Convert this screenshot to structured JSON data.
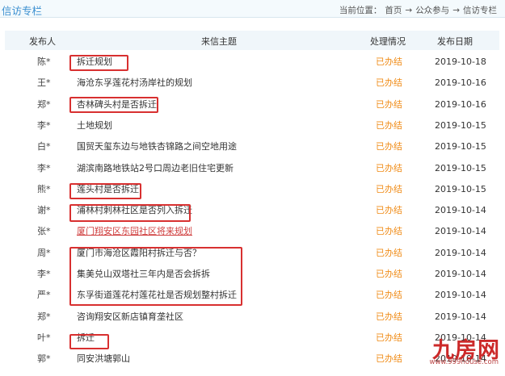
{
  "page": {
    "section_title": "信访专栏",
    "breadcrumb": {
      "label": "当前位置：",
      "home": "首页",
      "arrow": "→",
      "level1": "公众参与",
      "level2": "信访专栏"
    }
  },
  "table": {
    "headers": {
      "author": "发布人",
      "subject": "来信主题",
      "status": "处理情况",
      "date": "发布日期"
    },
    "rows": [
      {
        "author": "陈*",
        "subject": "拆迁规划",
        "status": "已办结",
        "date": "2019-10-18"
      },
      {
        "author": "王*",
        "subject": "海沧东孚莲花村汤岸社的规划",
        "status": "已办结",
        "date": "2019-10-16"
      },
      {
        "author": "郑*",
        "subject": "杏林碑头村是否拆迁",
        "status": "已办结",
        "date": "2019-10-16"
      },
      {
        "author": "李*",
        "subject": "土地规划",
        "status": "已办结",
        "date": "2019-10-15"
      },
      {
        "author": "白*",
        "subject": "国贸天玺东边与地铁杏锦路之间空地用途",
        "status": "已办结",
        "date": "2019-10-15"
      },
      {
        "author": "李*",
        "subject": "湖滨南路地铁站2号口周边老旧住宅更新",
        "status": "已办结",
        "date": "2019-10-15"
      },
      {
        "author": "熊*",
        "subject": "莲头村是否拆迁",
        "status": "已办结",
        "date": "2019-10-15"
      },
      {
        "author": "谢*",
        "subject": "浦林村刺林社区是否列入拆迁",
        "status": "已办结",
        "date": "2019-10-14"
      },
      {
        "author": "张*",
        "subject": "厦门翔安区东园社区将来规划",
        "status": "已办结",
        "date": "2019-10-14"
      },
      {
        "author": "周*",
        "subject": "厦门市海沧区霞阳村拆迁与否？",
        "status": "已办结",
        "date": "2019-10-14"
      },
      {
        "author": "李*",
        "subject": "集美兑山双塔社三年内是否会拆拆",
        "status": "已办结",
        "date": "2019-10-14"
      },
      {
        "author": "严*",
        "subject": "东孚街道莲花村莲花社是否规划整村拆迁",
        "status": "已办结",
        "date": "2019-10-14"
      },
      {
        "author": "郑*",
        "subject": "咨询翔安区新店镇育垄社区",
        "status": "已办结",
        "date": "2019-10-14"
      },
      {
        "author": "叶*",
        "subject": "拆迁",
        "status": "已办结",
        "date": "2019-10-14"
      },
      {
        "author": "郭*",
        "subject": "同安洪塘郭山",
        "status": "已办结",
        "date": "2019-10-14"
      }
    ]
  },
  "watermark": {
    "text": "九房网",
    "url": "www.999house.com"
  },
  "colors": {
    "accent": "#3a8fd0",
    "status": "#f08d1a",
    "highlight": "#d83030",
    "header_bg": "#f0f6fa"
  }
}
